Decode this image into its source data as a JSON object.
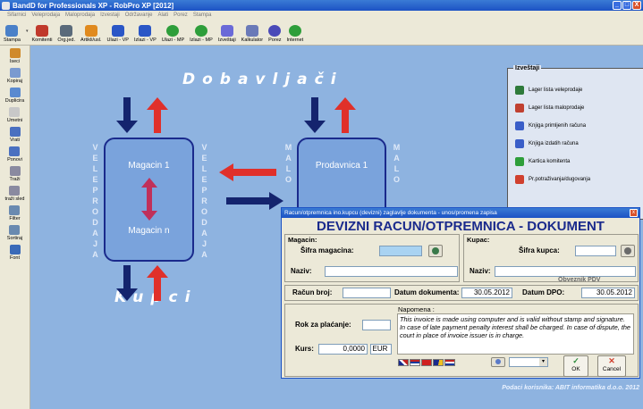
{
  "window": {
    "title": "BandD for Professionals XP - RobPro XP [2012]",
    "buttons": [
      "_",
      "□",
      "X"
    ]
  },
  "menu": [
    "Sifarnici",
    "Veleprodaja",
    "Maloprodaja",
    "Izvestaji",
    "Održavanje",
    "Alati",
    "Porez",
    "Stampa"
  ],
  "toolbar": [
    {
      "label": "Stampa",
      "icon": "printer-icon",
      "color": "#4a80c8"
    },
    {
      "label": "Komitenti",
      "icon": "people-icon",
      "color": "#c0392b"
    },
    {
      "label": "Org.jed.",
      "icon": "building-icon",
      "color": "#5a6a7a"
    },
    {
      "label": "Artikli/usl.",
      "icon": "box-icon",
      "color": "#e08a1e"
    },
    {
      "label": "Ulazi - VP",
      "icon": "forward-icon",
      "color": "#2a56c6"
    },
    {
      "label": "Izlazi - VP",
      "icon": "back-icon",
      "color": "#2a56c6"
    },
    {
      "label": "Ulazi - MP",
      "icon": "right-circle-icon",
      "color": "#2e9e3a"
    },
    {
      "label": "Izlazi - MP",
      "icon": "left-circle-icon",
      "color": "#2e9e3a"
    },
    {
      "label": "Izveštaji",
      "icon": "report-icon",
      "color": "#6a6ad8"
    },
    {
      "label": "Kalkulator",
      "icon": "calculator-icon",
      "color": "#6a7ab8"
    },
    {
      "label": "Porez",
      "icon": "tax-icon",
      "color": "#4a4ab8"
    },
    {
      "label": "Internet",
      "icon": "globe-icon",
      "color": "#2e9e3a"
    }
  ],
  "sidebar": [
    {
      "label": "Iseci",
      "icon": "scissors-icon",
      "color": "#d08a2a"
    },
    {
      "label": "Kopiraj",
      "icon": "copy-icon",
      "color": "#7a9ad0"
    },
    {
      "label": "Duplicira",
      "icon": "duplicate-icon",
      "color": "#5a8ad0"
    },
    {
      "label": "Umetni",
      "icon": "paste-icon",
      "color": "#c8c8c8"
    },
    {
      "label": "Vrati",
      "icon": "undo-icon",
      "color": "#4a70c0"
    },
    {
      "label": "Ponovi",
      "icon": "redo-icon",
      "color": "#4a70c0"
    },
    {
      "label": "Traži",
      "icon": "binoculars-icon",
      "color": "#8a8aa0"
    },
    {
      "label": "traži sled",
      "icon": "find-next-icon",
      "color": "#8a8aa0"
    },
    {
      "label": "Filter",
      "icon": "filter-icon",
      "color": "#6a8ab0"
    },
    {
      "label": "Sortiraj",
      "icon": "sort-icon",
      "color": "#6a8ab0"
    },
    {
      "label": "Font",
      "icon": "font-icon",
      "color": "#3a6ab8"
    }
  ],
  "diagram": {
    "suppliers_label": "Dobavljači",
    "customers_label": "Kupci",
    "wholesale_vertical": "VELEPRODAJA",
    "retail_vertical": "MALO",
    "warehouse_top": "Magacin 1",
    "warehouse_bottom": "Magacin n",
    "store_top": "Prodavnica 1"
  },
  "reports": {
    "title": "Izveštaji",
    "items": [
      {
        "label": "Lager lista veleprodaje",
        "icon": "stock-icon",
        "color": "#2e7a3a"
      },
      {
        "label": "Lager lista maloprodaje",
        "icon": "house-icon",
        "color": "#c04030"
      },
      {
        "label": "Knjiga primljenih računa",
        "icon": "forward-icon",
        "color": "#3a5ec8"
      },
      {
        "label": "Knjiga izdatih računa",
        "icon": "back-icon",
        "color": "#3a5ec8"
      },
      {
        "label": "Kartica komitenta",
        "icon": "person-icon",
        "color": "#2e9e3a"
      },
      {
        "label": "Pr.potraživanja/dugovanja",
        "icon": "chart-icon",
        "color": "#d0402e"
      }
    ]
  },
  "footer_note": "Podaci korisnika: ABIT informatika d.o.o. 2012",
  "dialog": {
    "title": "Racun/otpremnica ino.kupcu (devizni) zaglavlje dokumenta - unos/promena zapisa",
    "heading": "DEVIZNI RACUN/OTPREMNICA - DOKUMENT",
    "magacin_group": "Magacin:",
    "sifra_magacina_label": "Šifra magacina:",
    "sifra_magacina_value": "",
    "naziv_label": "Naziv:",
    "naziv_value": "",
    "kupac_group": "Kupac:",
    "sifra_kupca_label": "Šifra kupca:",
    "sifra_kupca_value": "",
    "kupac_naziv_label": "Naziv:",
    "kupac_naziv_value": "",
    "obveznik_pdv": "Obveznik PDV",
    "racun_broj_label": "Račun broj:",
    "racun_broj_value": "",
    "datum_dokumenta_label": "Datum dokumenta:",
    "datum_dokumenta_value": "30.05.2012",
    "datum_dpo_label": "Datum DPO:",
    "datum_dpo_value": "30.05.2012",
    "rok_label": "Rok za plaćanje:",
    "rok_value": "",
    "kurs_label": "Kurs:",
    "kurs_value": "0,0000",
    "currency": "EUR",
    "napomena_label": "Napomena :",
    "napomena_text": "This invoice is made using computer and is valid without stamp and signature. In case of late payment penalty interest shall be charged. In case of dispute, the court in place of invoice issuer is in charge.",
    "ok_label": "OK",
    "cancel_label": "Cancel"
  }
}
